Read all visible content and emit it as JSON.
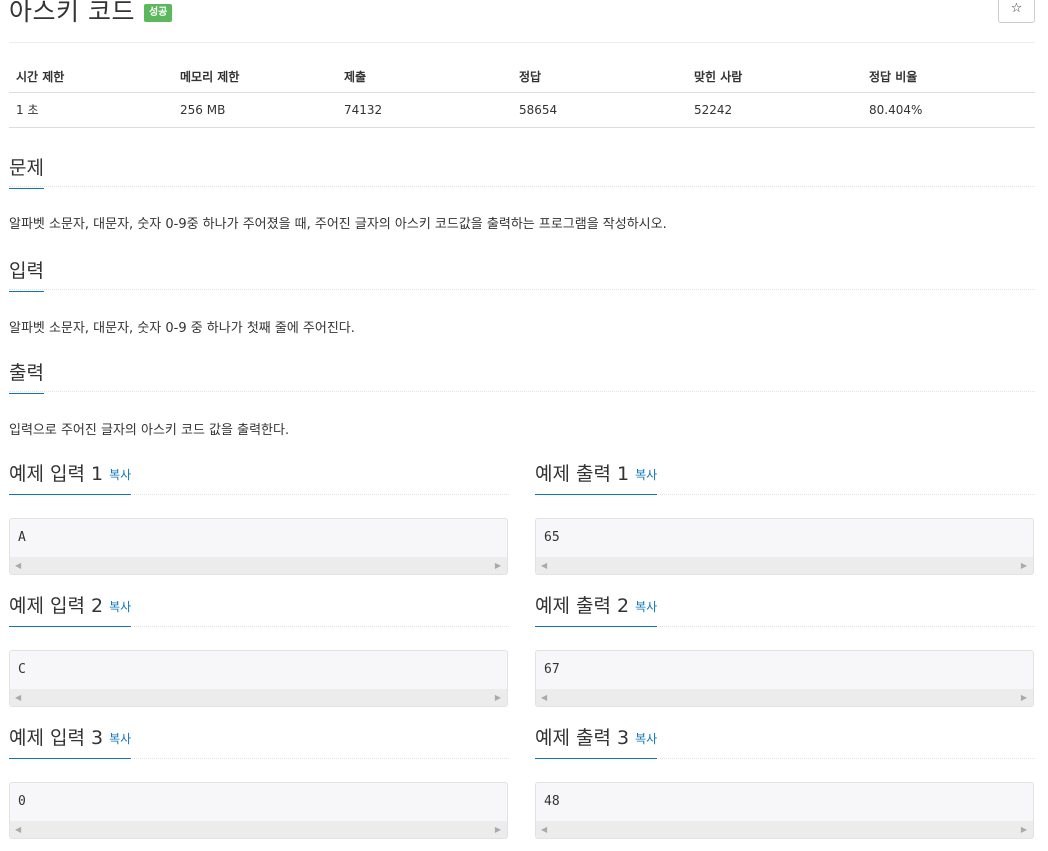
{
  "problem": {
    "title": "아스키 코드",
    "badge": "성공",
    "star_icon": "☆"
  },
  "info_table": {
    "headers": [
      "시간 제한",
      "메모리 제한",
      "제출",
      "정답",
      "맞힌 사람",
      "정답 비율"
    ],
    "values": [
      "1 초",
      "256 MB",
      "74132",
      "58654",
      "52242",
      "80.404%"
    ]
  },
  "sections": {
    "description": {
      "title": "문제",
      "text": "알파벳 소문자, 대문자, 숫자 0-9중 하나가 주어졌을 때, 주어진 글자의 아스키 코드값을 출력하는 프로그램을 작성하시오."
    },
    "input": {
      "title": "입력",
      "text": "알파벳 소문자, 대문자, 숫자 0-9 중 하나가 첫째 줄에 주어진다."
    },
    "output": {
      "title": "출력",
      "text": "입력으로 주어진 글자의 아스키 코드 값을 출력한다."
    }
  },
  "samples": [
    {
      "input_title": "예제 입력 1",
      "output_title": "예제 출력 1",
      "input": "A",
      "output": "65"
    },
    {
      "input_title": "예제 입력 2",
      "output_title": "예제 출력 2",
      "input": "C",
      "output": "67"
    },
    {
      "input_title": "예제 입력 3",
      "output_title": "예제 출력 3",
      "input": "0",
      "output": "48"
    }
  ],
  "copy_label": "복사",
  "scroll_left_icon": "◀",
  "scroll_right_icon": "▶",
  "colors": {
    "badge": "#5cb85c",
    "accent": "#0e76b8"
  }
}
